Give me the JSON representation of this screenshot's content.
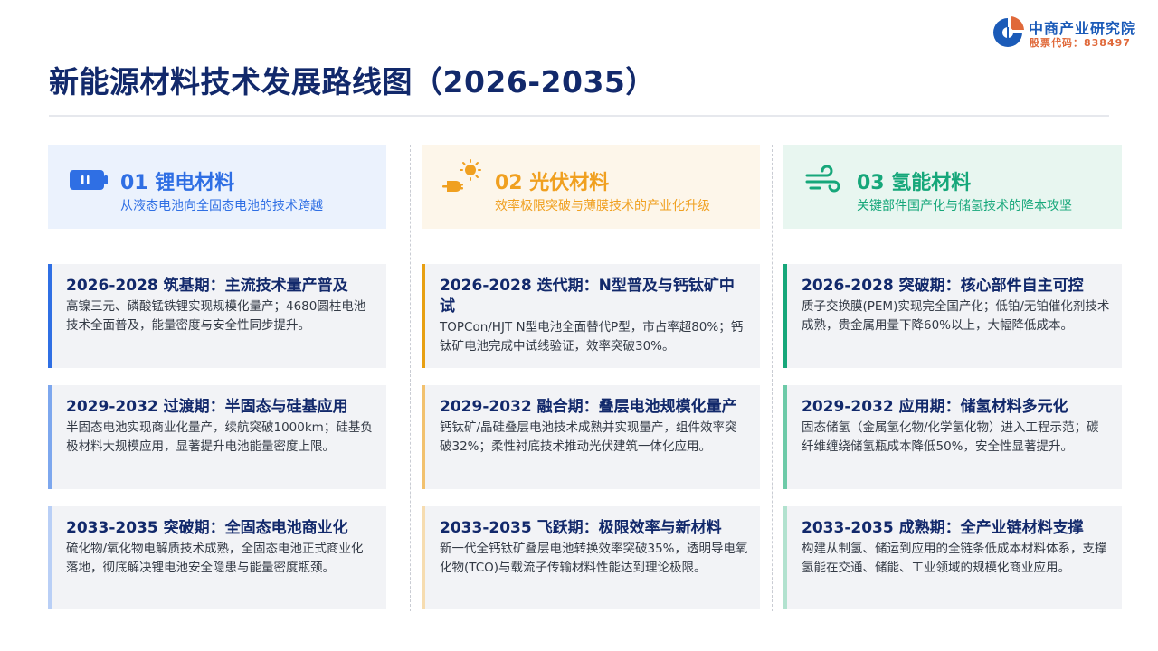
{
  "logo": {
    "name": "中商产业研究院",
    "code": "股票代码：838497"
  },
  "page": {
    "title": "新能源材料技术发展路线图（2026-2035）"
  },
  "columns": [
    {
      "title": "01 锂电材料",
      "subtitle": "从液态电池向全固态电池的技术跨越",
      "icon": "battery-icon",
      "accent": "#2f6fe4",
      "phases": [
        {
          "title": "2026-2028 筑基期：主流技术量产普及",
          "body": "高镍三元、磷酸锰铁锂实现规模化量产；4680圆柱电池技术全面普及，能量密度与安全性同步提升。"
        },
        {
          "title": "2029-2032 过渡期：半固态与硅基应用",
          "body": "半固态电池实现商业化量产，续航突破1000km；硅基负极材料大规模应用，显著提升电池能量密度上限。"
        },
        {
          "title": "2033-2035 突破期：全固态电池商业化",
          "body": "硫化物/氧化物电解质技术成熟，全固态电池正式商业化落地，彻底解决锂电池安全隐患与能量密度瓶颈。"
        }
      ]
    },
    {
      "title": "02 光伏材料",
      "subtitle": "效率极限突破与薄膜技术的产业化升级",
      "icon": "solar-plug-icon",
      "accent": "#f0a020",
      "phases": [
        {
          "title": "2026-2028 迭代期：N型普及与钙钛矿中试",
          "body": "TOPCon/HJT N型电池全面替代P型，市占率超80%；钙钛矿电池完成中试线验证，效率突破30%。"
        },
        {
          "title": "2029-2032 融合期：叠层电池规模化量产",
          "body": "钙钛矿/晶硅叠层电池技术成熟并实现量产，组件效率突破32%；柔性衬底技术推动光伏建筑一体化应用。"
        },
        {
          "title": "2033-2035 飞跃期：极限效率与新材料",
          "body": "新一代全钙钛矿叠层电池转换效率突破35%，透明导电氧化物(TCO)与载流子传输材料性能达到理论极限。"
        }
      ]
    },
    {
      "title": "03 氢能材料",
      "subtitle": "关键部件国产化与储氢技术的降本攻坚",
      "icon": "wind-icon",
      "accent": "#16a77a",
      "phases": [
        {
          "title": "2026-2028 突破期：核心部件自主可控",
          "body": "质子交换膜(PEM)实现完全国产化；低铂/无铂催化剂技术成熟，贵金属用量下降60%以上，大幅降低成本。"
        },
        {
          "title": "2029-2032 应用期：储氢材料多元化",
          "body": "固态储氢（金属氢化物/化学氢化物）进入工程示范；碳纤维缠绕储氢瓶成本降低50%，安全性显著提升。"
        },
        {
          "title": "2033-2035 成熟期：全产业链材料支撑",
          "body": "构建从制氢、储运到应用的全链条低成本材料体系，支撑氢能在交通、储能、工业领域的规模化商业应用。"
        }
      ]
    }
  ]
}
